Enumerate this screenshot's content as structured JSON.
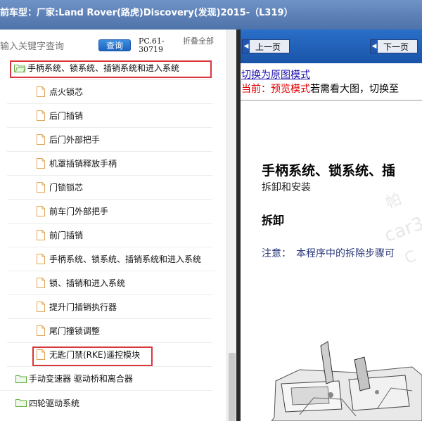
{
  "window": {
    "title": "前车型：厂家:Land Rover(路虎)Discovery(发现)2015-（L319）"
  },
  "search": {
    "placeholder": "输入关键字查询",
    "query_button": "查询",
    "pc_code": "PC.61-30719",
    "collapse_all": "折叠全部"
  },
  "tree": {
    "open_folder": "手柄系统、锁系统、插销系统和进入系统",
    "items": [
      "点火锁芯",
      "后门插销",
      "后门外部把手",
      "机罩插销释放手柄",
      "门锁锁芯",
      "前车门外部把手",
      "前门插销",
      "手柄系统、锁系统、插销系统和进入系统",
      "锁、插销和进入系统",
      "提升门插销执行器",
      "尾门撞锁调整",
      "无匙门禁(RKE)遥控模块"
    ],
    "folders": [
      "手动变速器 驱动桥和离合器",
      "四轮驱动系统"
    ]
  },
  "viewer": {
    "prev_button": "上一页",
    "next_button": "下一页",
    "switch_link": "切换为原图模式",
    "status_prefix": "当前：预览模式",
    "status_suffix": "若需看大图，切换至",
    "doc_title": "手柄系统、锁系统、插",
    "doc_subtitle": "拆卸和安装",
    "doc_section": "拆卸",
    "doc_note": "注意：　本程序中的拆除步骤可",
    "watermark_1": "帕",
    "watermark_2": "car3",
    "watermark_3": "C"
  },
  "colors": {
    "titlebar": "#5b7fb5",
    "highlight": "#d9363e",
    "query_button": "#1e64c0",
    "status_red": "#e00000",
    "link": "#1a0dab"
  }
}
